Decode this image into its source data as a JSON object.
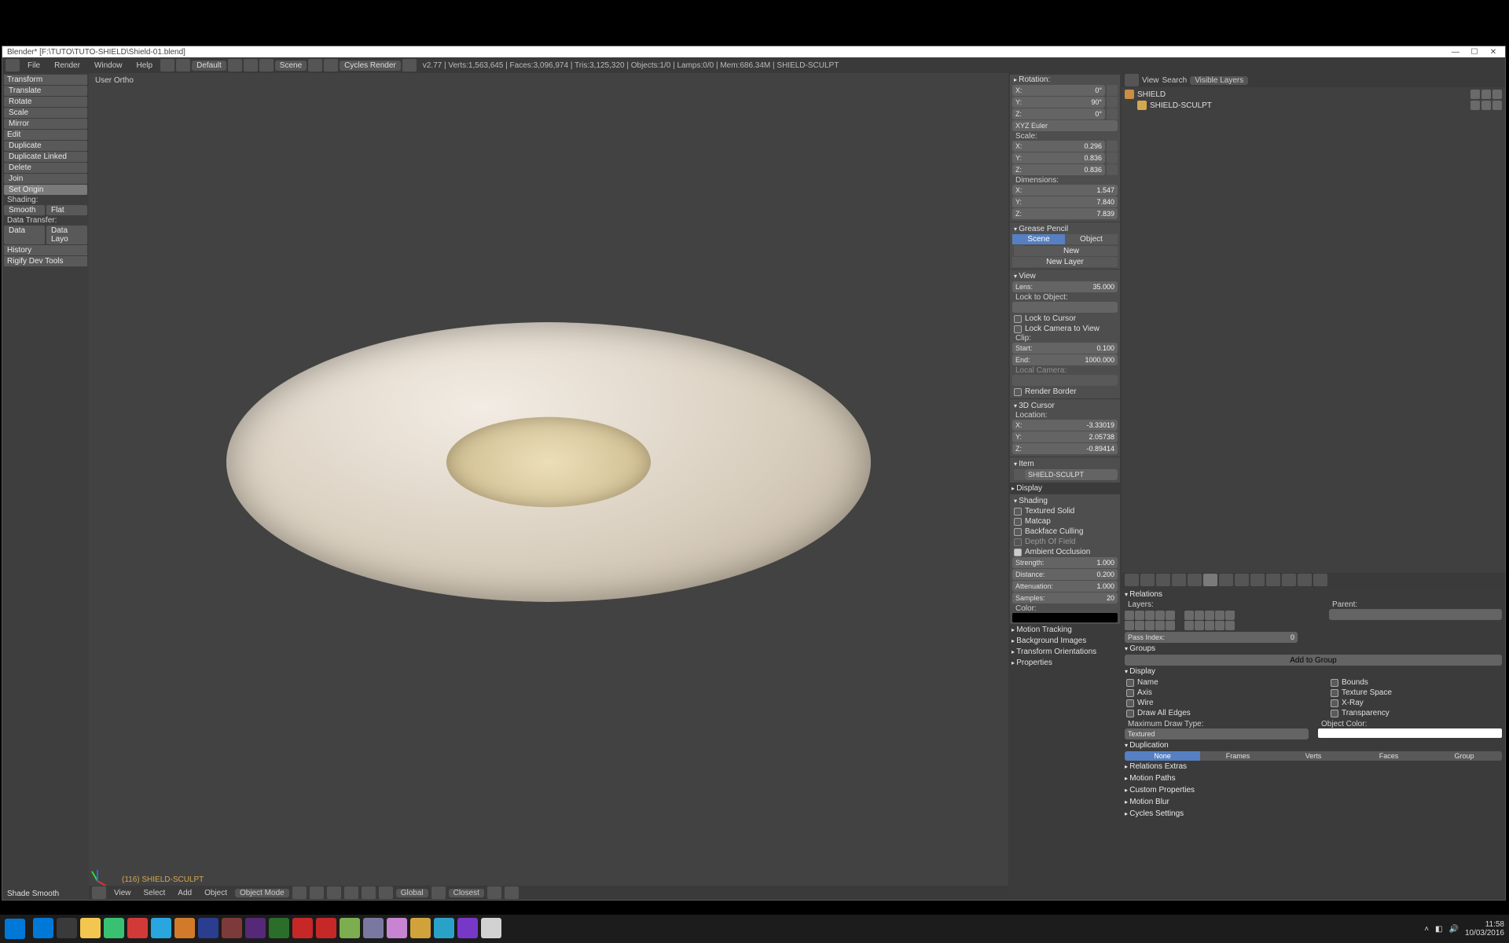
{
  "titlebar": {
    "title": "Blender* [F:\\TUTO\\TUTO-SHIELD\\Shield-01.blend]",
    "min": "—",
    "max": "☐",
    "close": "✕"
  },
  "menubar": {
    "items": [
      "File",
      "Render",
      "Window",
      "Help"
    ],
    "layout_label": "Default",
    "scene_label": "Scene",
    "renderer_label": "Cycles Render",
    "stats": "v2.77 | Verts:1,563,645 | Faces:3,096,974 | Tris:3,125,320 | Objects:1/0 | Lamps:0/0 | Mem:686.34M | SHIELD-SCULPT"
  },
  "tools": {
    "transform": {
      "title": "Transform",
      "translate": "Translate",
      "rotate": "Rotate",
      "scale": "Scale",
      "mirror": "Mirror"
    },
    "edit": {
      "title": "Edit",
      "duplicate": "Duplicate",
      "duplicate_linked": "Duplicate Linked",
      "delete": "Delete",
      "join": "Join",
      "set_origin": "Set Origin"
    },
    "shading": {
      "label": "Shading:",
      "smooth": "Smooth",
      "flat": "Flat"
    },
    "datatransfer": {
      "label": "Data Transfer:",
      "data": "Data",
      "data_layout": "Data Layo"
    },
    "history": {
      "title": "History"
    },
    "rigify": {
      "title": "Rigify Dev Tools"
    }
  },
  "viewport": {
    "persp": "User Ortho",
    "object": "(116) SHIELD-SCULPT",
    "status": "Shade Smooth",
    "toolbar": {
      "view": "View",
      "select": "Select",
      "add": "Add",
      "object": "Object",
      "mode": "Object Mode",
      "orient": "Global",
      "proportional": "Closest"
    }
  },
  "npanel": {
    "rotation": {
      "title": "Rotation:",
      "x": "0°",
      "y": "90°",
      "z": "0°",
      "mode": "XYZ Euler"
    },
    "scale": {
      "title": "Scale:",
      "x": "0.296",
      "y": "0.836",
      "z": "0.836"
    },
    "dim": {
      "title": "Dimensions:",
      "x": "1.547",
      "y": "7.840",
      "z": "7.839"
    },
    "gp": {
      "title": "Grease Pencil",
      "scene_tab": "Scene",
      "object_tab": "Object",
      "new": "New",
      "new_layer": "New Layer"
    },
    "view": {
      "title": "View",
      "lens_k": "Lens:",
      "lens_v": "35.000",
      "lock_obj": "Lock to Object:",
      "lock_cursor": "Lock to Cursor",
      "lock_cam": "Lock Camera to View",
      "clip": "Clip:",
      "start_k": "Start:",
      "start_v": "0.100",
      "end_k": "End:",
      "end_v": "1000.000",
      "localcam": "Local Camera:",
      "render_border": "Render Border"
    },
    "cursor": {
      "title": "3D Cursor",
      "loc": "Location:",
      "x": "-3.33019",
      "y": "2.05738",
      "z": "-0.89414"
    },
    "item": {
      "title": "Item",
      "name": "SHIELD-SCULPT"
    },
    "display_sect": {
      "title": "Display"
    },
    "shading_sect": {
      "title": "Shading",
      "tex_solid": "Textured Solid",
      "matcap": "Matcap",
      "backface": "Backface Culling",
      "dof": "Depth Of Field",
      "ao": "Ambient Occlusion",
      "strength_k": "Strength:",
      "strength_v": "1.000",
      "distance_k": "Distance:",
      "distance_v": "0.200",
      "atten_k": "Attenuation:",
      "atten_v": "1.000",
      "samples_k": "Samples:",
      "samples_v": "20",
      "color": "Color:"
    },
    "motion": {
      "title": "Motion Tracking"
    },
    "bg": {
      "title": "Background Images"
    },
    "torient": {
      "title": "Transform Orientations"
    },
    "props": {
      "title": "Properties"
    }
  },
  "outliner": {
    "view": "View",
    "search": "Search",
    "filter": "Visible Layers",
    "root": "SHIELD",
    "child": "SHIELD-SCULPT"
  },
  "properties": {
    "relations": {
      "title": "Relations",
      "layers": "Layers:",
      "parent": "Parent:",
      "pass_k": "Pass Index:",
      "pass_v": "0"
    },
    "groups": {
      "title": "Groups",
      "add": "Add to Group"
    },
    "display": {
      "title": "Display",
      "name": "Name",
      "axis": "Axis",
      "wire": "Wire",
      "draw_all": "Draw All Edges",
      "bounds": "Bounds",
      "tex_space": "Texture Space",
      "xray": "X-Ray",
      "transparency": "Transparency",
      "max_draw": "Maximum Draw Type:",
      "obj_color": "Object Color:",
      "textured": "Textured"
    },
    "dup": {
      "title": "Duplication",
      "none": "None",
      "frames": "Frames",
      "verts": "Verts",
      "faces": "Faces",
      "group": "Group"
    },
    "rel_extras": {
      "title": "Relations Extras"
    },
    "motion_paths": {
      "title": "Motion Paths"
    },
    "custom": {
      "title": "Custom Properties"
    },
    "motion_blur": {
      "title": "Motion Blur"
    },
    "cycles": {
      "title": "Cycles Settings"
    }
  },
  "taskbar": {
    "apps": [
      "#0078d7",
      "#3a3a3a",
      "#f3c64f",
      "#38c172",
      "#d23a3a",
      "#29a6de",
      "#d27a2a",
      "#2b3d8f",
      "#7d3a3a",
      "#562878",
      "#2a6e2a",
      "#c62828",
      "#c62828",
      "#7cae4f",
      "#7878a0",
      "#c784d2",
      "#d2a23a",
      "#2aa2c7",
      "#7838c7",
      "#d2d2d2"
    ],
    "time": "11:58",
    "date": "10/03/2016"
  }
}
